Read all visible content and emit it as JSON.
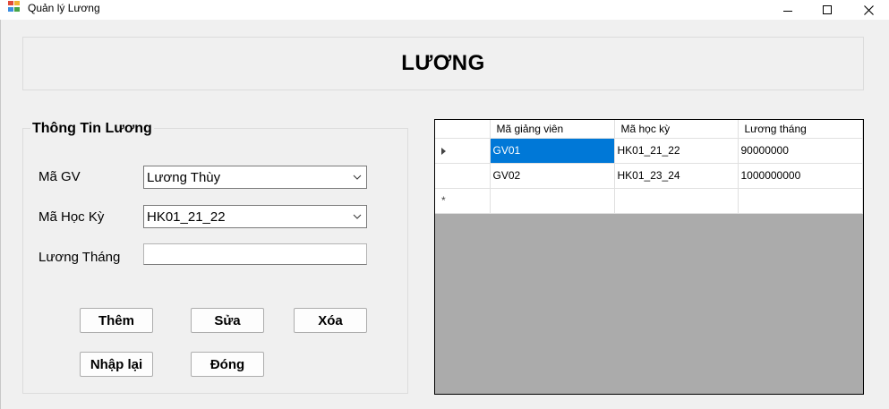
{
  "window": {
    "title": "Quản lý Lương",
    "icon": "app-window-icon",
    "controls": [
      "minimize-icon",
      "maximize-icon",
      "close-icon"
    ]
  },
  "header": {
    "title": "LƯƠNG"
  },
  "form": {
    "group_title": "Thông Tin Lương",
    "ma_gv_label": "Mã GV",
    "ma_gv_value": "Lương Thùy",
    "ma_hoc_ky_label": "Mã Học Kỳ",
    "ma_hoc_ky_value": "HK01_21_22",
    "luong_thang_label": "Lương Tháng",
    "luong_thang_value": ""
  },
  "buttons": {
    "them": "Thêm",
    "sua": "Sửa",
    "xoa": "Xóa",
    "nhap_lai": "Nhập lại",
    "dong": "Đóng"
  },
  "grid": {
    "columns": [
      "Mã giảng viên",
      "Mã học kỳ",
      "Lương tháng"
    ],
    "rows": [
      [
        "GV01",
        "HK01_21_22",
        "90000000"
      ],
      [
        "GV02",
        "HK01_23_24",
        "1000000000"
      ]
    ],
    "new_row_marker": "*"
  },
  "colors": {
    "selection": "#0078d7",
    "grid_background": "#ababab",
    "form_background": "#f0f0f0"
  }
}
